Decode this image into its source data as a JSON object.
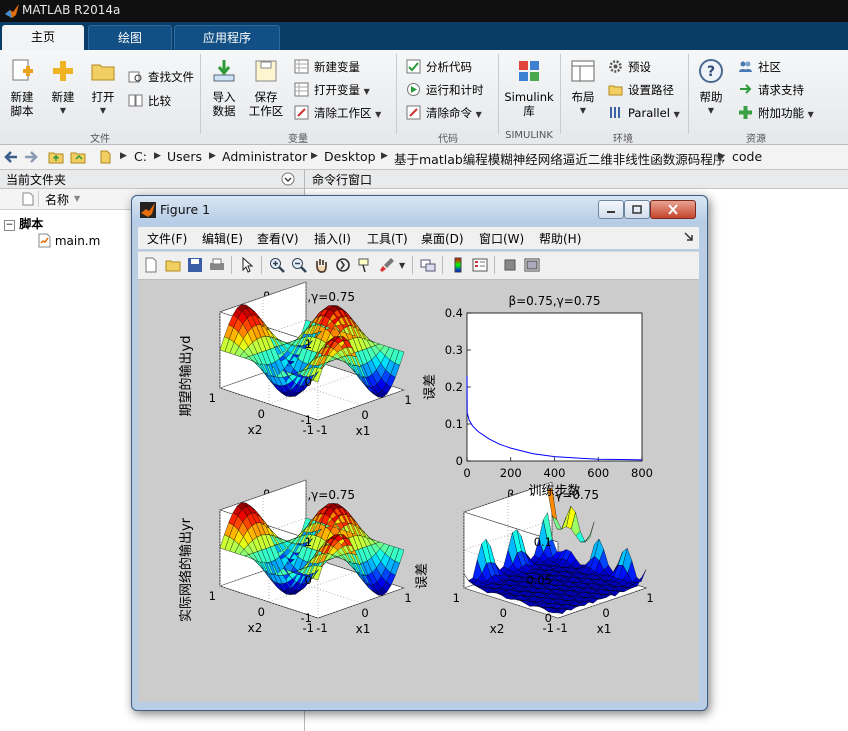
{
  "app": {
    "title": "MATLAB R2014a"
  },
  "ribbon_tabs": [
    {
      "label": "主页",
      "active": true
    },
    {
      "label": "绘图",
      "active": false
    },
    {
      "label": "应用程序",
      "active": false
    }
  ],
  "ribbon": {
    "file": {
      "group_label": "文件",
      "new_script": [
        "新建",
        "脚本"
      ],
      "new": "新建",
      "open": "打开",
      "find_files": "查找文件",
      "compare": "比较"
    },
    "variable": {
      "group_label": "变量",
      "import": [
        "导入",
        "数据"
      ],
      "save_ws": [
        "保存",
        "工作区"
      ],
      "new_var": "新建变量",
      "open_var": "打开变量",
      "clear_ws": "清除工作区"
    },
    "code": {
      "group_label": "代码",
      "analyze": "分析代码",
      "run_time": "运行和计时",
      "clear_cmd": "清除命令"
    },
    "simulink": {
      "group_label": "SIMULINK",
      "lib": [
        "Simulink",
        "库"
      ]
    },
    "env": {
      "group_label": "环境",
      "layout": "布局",
      "prefs": "预设",
      "set_path": "设置路径",
      "parallel": "Parallel"
    },
    "resources": {
      "group_label": "资源",
      "help": "帮助",
      "community": "社区",
      "support": "请求支持",
      "addons": "附加功能"
    }
  },
  "address_bar": {
    "path": [
      "C:",
      "Users",
      "Administrator",
      "Desktop",
      "基于matlab编程模糊神经网络逼近二维非线性函数源码程序",
      "code"
    ]
  },
  "current_folder": {
    "title": "当前文件夹",
    "column_name": "名称",
    "group": "脚本",
    "files": [
      "main.m"
    ]
  },
  "command_window": {
    "title": "命令行窗口"
  },
  "figure": {
    "title": "Figure 1",
    "menu": [
      "文件(F)",
      "编辑(E)",
      "查看(V)",
      "插入(I)",
      "工具(T)",
      "桌面(D)",
      "窗口(W)",
      "帮助(H)"
    ],
    "toolbar_icons": [
      "new-figure-icon",
      "open-file-icon",
      "save-icon",
      "print-icon",
      "pointer-icon",
      "zoom-in-icon",
      "zoom-out-icon",
      "pan-hand-icon",
      "rotate3d-icon",
      "data-cursor-icon",
      "brush-icon",
      "link-plot-icon",
      "colorbar-icon",
      "legend-icon",
      "hide-plot-tools-icon",
      "show-plot-tools-icon"
    ]
  },
  "chart_data": [
    {
      "type": "surface",
      "title": "β=0.75,γ=0.75",
      "xlabel": "x1",
      "ylabel": "x2",
      "zlabel": "期望的输出yd",
      "xlim": [
        -1,
        1
      ],
      "ylim": [
        -1,
        1
      ],
      "zlim": [
        -1,
        1
      ],
      "x_ticks": [
        "-1",
        "0",
        "1"
      ],
      "y_ticks": [
        "-1",
        "0",
        "1"
      ],
      "z_ticks": [
        "-1",
        "0",
        "1"
      ],
      "colormap": "jet",
      "grid": true
    },
    {
      "type": "line",
      "title": "β=0.75,γ=0.75",
      "xlabel": "训练步数",
      "ylabel": "误差",
      "xlim": [
        0,
        800
      ],
      "ylim": [
        0,
        0.4
      ],
      "x_ticks": [
        "0",
        "200",
        "400",
        "600",
        "800"
      ],
      "y_ticks": [
        "0",
        "0.1",
        "0.2",
        "0.3",
        "0.4"
      ],
      "series": [
        {
          "color": "#0000ff",
          "x": [
            0,
            1,
            10,
            25,
            50,
            100,
            150,
            200,
            300,
            400,
            500,
            600,
            700,
            800
          ],
          "y": [
            0.23,
            0.13,
            0.11,
            0.095,
            0.08,
            0.06,
            0.045,
            0.035,
            0.02,
            0.012,
            0.008,
            0.005,
            0.004,
            0.003
          ]
        }
      ]
    },
    {
      "type": "surface",
      "title": "β=0.75,γ=0.75",
      "xlabel": "x1",
      "ylabel": "x2",
      "zlabel": "实际网络的输出yr",
      "xlim": [
        -1,
        1
      ],
      "ylim": [
        -1,
        1
      ],
      "zlim": [
        -1,
        1
      ],
      "x_ticks": [
        "-1",
        "0",
        "1"
      ],
      "y_ticks": [
        "-1",
        "0",
        "1"
      ],
      "z_ticks": [
        "-1",
        "0",
        "1"
      ],
      "colormap": "jet",
      "grid": true
    },
    {
      "type": "surface",
      "title": "β=0.75,γ=0.75",
      "xlabel": "x1",
      "ylabel": "x2",
      "zlabel": "误差",
      "xlim": [
        -1,
        1
      ],
      "ylim": [
        -1,
        1
      ],
      "zlim": [
        0,
        0.1
      ],
      "x_ticks": [
        "-1",
        "0",
        "1"
      ],
      "y_ticks": [
        "-1",
        "0",
        "1"
      ],
      "z_ticks": [
        "0",
        "0.05",
        "0.1"
      ],
      "colormap": "jet",
      "grid": true
    }
  ]
}
